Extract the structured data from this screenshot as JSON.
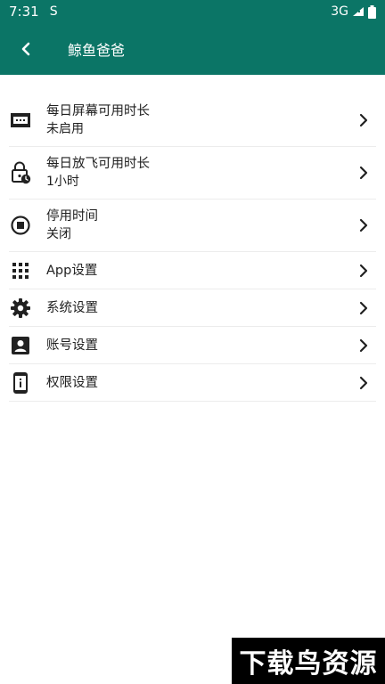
{
  "status_bar": {
    "time": "7:31",
    "sync_glyph": "S",
    "network": "3G"
  },
  "app_bar": {
    "title": "鲸鱼爸爸"
  },
  "menu": [
    {
      "title": "每日屏幕可用时长",
      "subtitle": "未启用",
      "icon": "screen-time-icon"
    },
    {
      "title": "每日放飞可用时长",
      "subtitle": "1小时",
      "icon": "lock-clock-icon"
    },
    {
      "title": "停用时间",
      "subtitle": "关闭",
      "icon": "stop-circle-icon"
    },
    {
      "title": "App设置",
      "icon": "apps-grid-icon"
    },
    {
      "title": "系统设置",
      "icon": "gear-icon"
    },
    {
      "title": "账号设置",
      "icon": "account-box-icon"
    },
    {
      "title": "权限设置",
      "icon": "phone-info-icon"
    }
  ],
  "watermark": {
    "text": "下载鸟资源"
  },
  "colors": {
    "primary": "#0b7566",
    "text": "#212121",
    "divider": "#ececec"
  }
}
